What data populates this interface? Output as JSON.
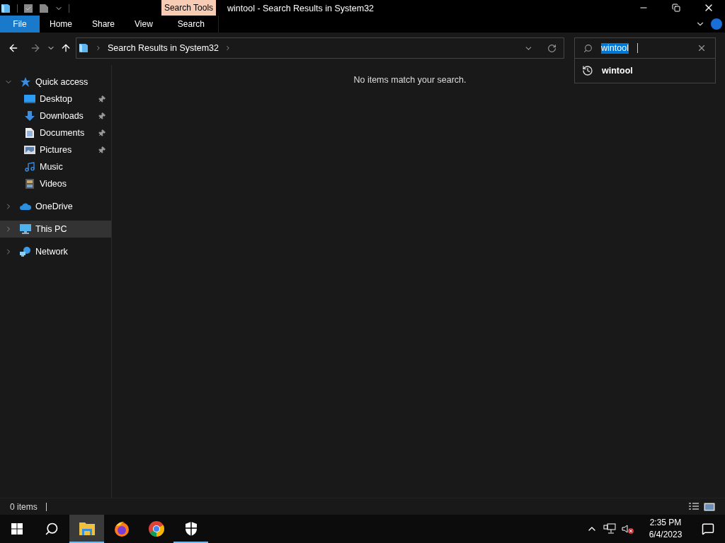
{
  "title_bar": {
    "context_tab": "Search Tools",
    "title": "wintool - Search Results in System32"
  },
  "ribbon_tabs": [
    {
      "label": "File",
      "kind": "file"
    },
    {
      "label": "Home",
      "kind": "tab"
    },
    {
      "label": "Share",
      "kind": "tab"
    },
    {
      "label": "View",
      "kind": "tab"
    },
    {
      "label": "Search",
      "kind": "context"
    }
  ],
  "address_bar": {
    "path": "Search Results in System32"
  },
  "search": {
    "value": "wintool",
    "text_selected": true
  },
  "suggestions": [
    {
      "text": "wintool"
    }
  ],
  "navigation": [
    {
      "label": "Quick access",
      "expanded": true,
      "selected": false,
      "children": [
        {
          "label": "Desktop",
          "pinned": true,
          "selected": false
        },
        {
          "label": "Downloads",
          "pinned": true,
          "selected": false
        },
        {
          "label": "Documents",
          "pinned": true,
          "selected": false
        },
        {
          "label": "Pictures",
          "pinned": true,
          "selected": false
        },
        {
          "label": "Music",
          "pinned": false,
          "selected": false
        },
        {
          "label": "Videos",
          "pinned": false,
          "selected": false
        }
      ]
    },
    {
      "label": "OneDrive",
      "expanded": false,
      "selected": false
    },
    {
      "label": "This PC",
      "expanded": false,
      "selected": true
    },
    {
      "label": "Network",
      "expanded": false,
      "selected": false
    }
  ],
  "message": "No items match your search.",
  "status_bar": {
    "item_count": "0 items"
  },
  "taskbar_apps": [
    {
      "active": true,
      "running": true
    },
    {
      "active": false,
      "running": false
    },
    {
      "active": false,
      "running": false
    },
    {
      "active": false,
      "running": true
    }
  ],
  "tray": {
    "time": "2:35 PM",
    "date": "6/4/2023"
  }
}
